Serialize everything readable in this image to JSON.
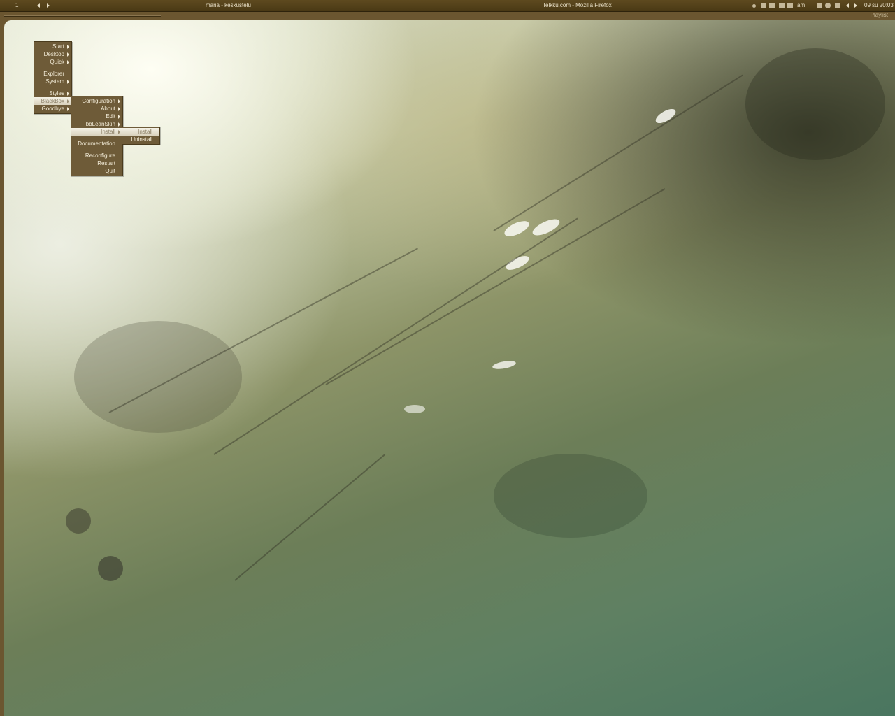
{
  "taskbar": {
    "workspace": "1",
    "task_left": "maria - keskustelu",
    "task_center": "Telkku.com - Mozilla Firefox",
    "tray_text": "am",
    "clock": "09 su 20:03"
  },
  "playlist_label": "Playlist",
  "root_menu": {
    "items": [
      {
        "label": "Start",
        "submenu": true
      },
      {
        "label": "Desktop",
        "submenu": true
      },
      {
        "label": "Quick",
        "submenu": true
      },
      {
        "label": "Explorer",
        "submenu": false
      },
      {
        "label": "System",
        "submenu": true
      },
      {
        "label": "Styles",
        "submenu": true
      },
      {
        "label": "BlackBox",
        "submenu": true,
        "highlighted": true
      },
      {
        "label": "Goodbye",
        "submenu": true
      }
    ]
  },
  "blackbox_menu": {
    "items": [
      {
        "label": "Configuration",
        "submenu": true
      },
      {
        "label": "About",
        "submenu": true
      },
      {
        "label": "Edit",
        "submenu": true
      },
      {
        "label": "bbLeanSkin",
        "submenu": true
      },
      {
        "label": "Install",
        "submenu": true,
        "highlighted": true
      },
      {
        "label": "Documentation",
        "submenu": false
      },
      {
        "label": "Reconfigure",
        "submenu": false
      },
      {
        "label": "Restart",
        "submenu": false
      },
      {
        "label": "Quit",
        "submenu": false
      }
    ]
  },
  "install_menu": {
    "items": [
      {
        "label": "Install",
        "highlighted": true
      },
      {
        "label": "Uninstall"
      }
    ]
  },
  "colors": {
    "taskbar": "#4a3915",
    "menu_bg": "#6e5b38",
    "menu_text": "#f3ecd8",
    "menu_highlight": "#ebe6d6"
  }
}
